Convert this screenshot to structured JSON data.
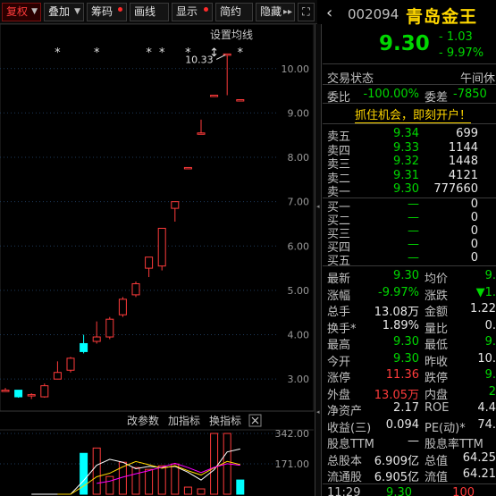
{
  "toolbar": {
    "buttons": [
      {
        "label": "复权",
        "active": true
      },
      {
        "label": "叠加"
      },
      {
        "label": "筹码"
      },
      {
        "label": "画线"
      },
      {
        "label": "显示"
      },
      {
        "label": "简约"
      },
      {
        "label": "隐藏"
      }
    ],
    "fullscreen_icon": "expand-icon"
  },
  "chart": {
    "ma_settings_label": "设置均线",
    "high_annotation": "10.33",
    "price_ticks": [
      "10.00",
      "9.00",
      "8.00",
      "7.00",
      "6.00",
      "5.00",
      "4.00",
      "3.00"
    ],
    "volume_ticks": [
      "342.00",
      "171.00"
    ],
    "indicator_buttons": [
      "改参数",
      "加指标",
      "换指标"
    ],
    "close_icon": "close-icon",
    "markers": [
      "*",
      "*",
      "*",
      "*",
      "*",
      "↕",
      "*"
    ],
    "colors": {
      "up": "#ff3b3b",
      "down": "#00ffff",
      "ma1": "#ffffff",
      "ma2": "#ffd700",
      "ma3": "#ff00ff"
    }
  },
  "chart_data": {
    "type": "candlestick",
    "candles": [
      {
        "o": 2.75,
        "c": 2.75,
        "h": 2.8,
        "l": 2.72
      },
      {
        "o": 2.75,
        "c": 2.6,
        "h": 2.75,
        "l": 2.58
      },
      {
        "o": 2.65,
        "c": 2.65,
        "h": 2.68,
        "l": 2.55
      },
      {
        "o": 2.6,
        "c": 2.85,
        "h": 2.9,
        "l": 2.58
      },
      {
        "o": 3.0,
        "c": 3.15,
        "h": 3.4,
        "l": 3.0
      },
      {
        "o": 3.2,
        "c": 3.47,
        "h": 3.5,
        "l": 3.15
      },
      {
        "o": 3.8,
        "c": 3.62,
        "h": 4.0,
        "l": 3.58
      },
      {
        "o": 3.85,
        "c": 3.95,
        "h": 4.3,
        "l": 3.8
      },
      {
        "o": 3.95,
        "c": 4.35,
        "h": 4.4,
        "l": 3.9
      },
      {
        "o": 4.45,
        "c": 4.8,
        "h": 4.85,
        "l": 4.4
      },
      {
        "o": 4.9,
        "c": 5.15,
        "h": 5.2,
        "l": 4.85
      },
      {
        "o": 5.5,
        "c": 5.75,
        "h": 5.75,
        "l": 5.3
      },
      {
        "o": 5.55,
        "c": 6.4,
        "h": 6.4,
        "l": 5.45
      },
      {
        "o": 6.85,
        "c": 7.0,
        "h": 7.0,
        "l": 6.55
      },
      {
        "o": 7.77,
        "c": 7.77,
        "h": 7.77,
        "l": 7.77
      },
      {
        "o": 8.55,
        "c": 8.55,
        "h": 8.85,
        "l": 8.55
      },
      {
        "o": 9.4,
        "c": 9.4,
        "h": 9.4,
        "l": 9.4
      },
      {
        "o": 10.33,
        "c": 10.33,
        "h": 10.33,
        "l": 9.4
      },
      {
        "o": 9.3,
        "c": 9.3,
        "h": 9.3,
        "l": 9.3
      }
    ],
    "volumes": [
      {
        "v": 0,
        "up": true
      },
      {
        "v": 0,
        "up": true
      },
      {
        "v": 0,
        "up": true
      },
      {
        "v": 0,
        "up": true
      },
      {
        "v": 0,
        "up": true
      },
      {
        "v": 0,
        "up": true
      },
      {
        "v": 230,
        "up": false
      },
      {
        "v": 260,
        "up": true
      },
      {
        "v": 100,
        "up": true
      },
      {
        "v": 180,
        "up": true
      },
      {
        "v": 150,
        "up": true
      },
      {
        "v": 140,
        "up": true
      },
      {
        "v": 160,
        "up": true
      },
      {
        "v": 170,
        "up": true
      },
      {
        "v": 40,
        "up": true
      },
      {
        "v": 30,
        "up": true
      },
      {
        "v": 342,
        "up": true
      },
      {
        "v": 342,
        "up": true
      },
      {
        "v": 80,
        "up": false
      }
    ],
    "ylim": [
      2.5,
      10.6
    ],
    "vol_ylim": [
      0,
      342
    ]
  },
  "quote": {
    "code": "002094",
    "name": "青岛金王",
    "price": "9.30",
    "change": "- 1.03",
    "change_pct": "- 9.97%",
    "trade_status_label": "交易状态",
    "trade_status": "午间休",
    "weibi_label": "委比",
    "weibi": "-100.00%",
    "weicha_label": "委差",
    "weicha": "-7850",
    "ad_text": "抓住机会，即刻开户！",
    "sells": [
      {
        "label": "卖五",
        "price": "9.34",
        "vol": "699"
      },
      {
        "label": "卖四",
        "price": "9.33",
        "vol": "1144"
      },
      {
        "label": "卖三",
        "price": "9.32",
        "vol": "1448"
      },
      {
        "label": "卖二",
        "price": "9.31",
        "vol": "4121"
      },
      {
        "label": "卖一",
        "price": "9.30",
        "vol": "777660"
      }
    ],
    "buys": [
      {
        "label": "买一",
        "price": "—",
        "vol": "0"
      },
      {
        "label": "买二",
        "price": "—",
        "vol": "0"
      },
      {
        "label": "买三",
        "price": "—",
        "vol": "0"
      },
      {
        "label": "买四",
        "price": "—",
        "vol": "0"
      },
      {
        "label": "买五",
        "price": "—",
        "vol": "0"
      }
    ],
    "stats": [
      {
        "l1": "最新",
        "v1": "9.30",
        "c1": "green",
        "l2": "均价",
        "v2": "9.",
        "c2": "green"
      },
      {
        "l1": "涨幅",
        "v1": "-9.97%",
        "c1": "green",
        "l2": "涨跌",
        "v2": "▼1.",
        "c2": "green"
      },
      {
        "l1": "总手",
        "v1": "13.08万",
        "c1": "white",
        "l2": "金额",
        "v2": "1.22",
        "c2": "white"
      },
      {
        "l1": "换手*",
        "v1": "1.89%",
        "c1": "white",
        "l2": "量比",
        "v2": "0.",
        "c2": "white"
      },
      {
        "l1": "最高",
        "v1": "9.30",
        "c1": "green",
        "l2": "最低",
        "v2": "9.",
        "c2": "green"
      },
      {
        "l1": "今开",
        "v1": "9.30",
        "c1": "green",
        "l2": "昨收",
        "v2": "10.",
        "c2": "white"
      },
      {
        "l1": "涨停",
        "v1": "11.36",
        "c1": "red",
        "l2": "跌停",
        "v2": "9.",
        "c2": "green"
      },
      {
        "l1": "外盘",
        "v1": "13.05万",
        "c1": "red",
        "l2": "内盘",
        "v2": "2",
        "c2": "green"
      },
      {
        "l1": "净资产",
        "v1": "2.17",
        "c1": "white",
        "l2": "ROE",
        "v2": "4.4",
        "c2": "white"
      },
      {
        "l1": "收益(三)",
        "v1": "0.094",
        "c1": "white",
        "l2": "PE(动)*",
        "v2": "74.",
        "c2": "white"
      },
      {
        "l1": "股息TTM",
        "v1": "—",
        "c1": "white",
        "l2": "股息率TTM",
        "v2": "",
        "c2": "white"
      },
      {
        "l1": "总股本",
        "v1": "6.909亿",
        "c1": "white",
        "l2": "总值",
        "v2": "64.25",
        "c2": "white"
      },
      {
        "l1": "流通股",
        "v1": "6.905亿",
        "c1": "white",
        "l2": "流值",
        "v2": "64.21",
        "c2": "white"
      }
    ],
    "tick": {
      "time": "11:29",
      "price": "9.30",
      "vol": "100"
    }
  }
}
